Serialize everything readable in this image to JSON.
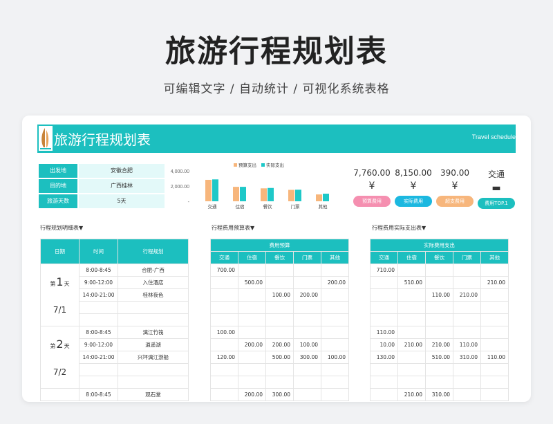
{
  "hero": {
    "title": "旅游行程规划表",
    "subtitle": "可编辑文字 / 自动统计 / 可视化系统表格"
  },
  "banner": {
    "title": "旅游行程规划表",
    "en": "Travel schedule"
  },
  "info": [
    {
      "key": "出发地",
      "value": "安徽合肥"
    },
    {
      "key": "目的地",
      "value": "广西桂林"
    },
    {
      "key": "旅游天数",
      "value": "5天"
    }
  ],
  "chart_data": {
    "type": "bar",
    "categories": [
      "交通",
      "住宿",
      "餐饮",
      "门票",
      "其他"
    ],
    "series": [
      {
        "name": "预算支出",
        "color": "#f7b67c",
        "values": [
          2820,
          1900,
          1700,
          1500,
          900
        ]
      },
      {
        "name": "实际支出",
        "color": "#1ec8c8",
        "values": [
          2880,
          1900,
          1750,
          1520,
          1000
        ]
      }
    ],
    "ylim": [
      0,
      4000
    ],
    "yticks": [
      "4,000.00",
      "2,000.00",
      "-"
    ],
    "legend": "top"
  },
  "kpis": [
    {
      "value": "7,760.00",
      "icon": "¥",
      "label": "预算费用",
      "color": "#f58fb0"
    },
    {
      "value": "8,150.00",
      "icon": "¥",
      "label": "实际费用",
      "color": "#1cb8e0"
    },
    {
      "value": "390.00",
      "icon": "¥",
      "label": "超支费用",
      "color": "#f7b67c"
    },
    {
      "value": "交通",
      "icon": "▬",
      "label": "费用TOP.1",
      "color": "#1cbfbf"
    }
  ],
  "sections": {
    "detail": "行程规划明细表▼",
    "budget": "行程费用预算表▼",
    "actual": "行程费用实际支出表▼"
  },
  "detail_table": {
    "headers": [
      "日期",
      "时间",
      "行程规划"
    ],
    "days": [
      {
        "num": "1",
        "prefix": "第",
        "suffix": "天",
        "date": "7/1",
        "rows": [
          [
            "8:00-8:45",
            "合肥-广西"
          ],
          [
            "9:00-12:00",
            "入住酒店"
          ],
          [
            "14:00-21:00",
            "桂林夜色"
          ],
          [
            "",
            ""
          ],
          [
            "",
            ""
          ]
        ]
      },
      {
        "num": "2",
        "prefix": "第",
        "suffix": "天",
        "date": "7/2",
        "rows": [
          [
            "8:00-8:45",
            "漓江竹筏"
          ],
          [
            "9:00-12:00",
            "逍遥湖"
          ],
          [
            "14:00-21:00",
            "兴坪漓江游船"
          ],
          [
            "",
            ""
          ],
          [
            "",
            ""
          ]
        ]
      }
    ],
    "last_row": [
      "8:00-8:45",
      "观石堂"
    ]
  },
  "budget_table": {
    "group": "费用预算",
    "headers": [
      "交通",
      "住宿",
      "餐饮",
      "门票",
      "其他"
    ],
    "rows": [
      [
        "700.00",
        "",
        "",
        "",
        ""
      ],
      [
        "",
        "500.00",
        "",
        "",
        "200.00"
      ],
      [
        "",
        "",
        "100.00",
        "200.00",
        ""
      ],
      [
        "",
        "",
        "",
        "",
        ""
      ],
      [
        "",
        "",
        "",
        "",
        ""
      ],
      [
        "100.00",
        "",
        "",
        "",
        ""
      ],
      [
        "",
        "200.00",
        "200.00",
        "100.00",
        ""
      ],
      [
        "120.00",
        "",
        "500.00",
        "300.00",
        "100.00"
      ],
      [
        "",
        "",
        "",
        "",
        ""
      ],
      [
        "",
        "",
        "",
        "",
        ""
      ],
      [
        "",
        "200.00",
        "300.00",
        "",
        ""
      ]
    ]
  },
  "actual_table": {
    "group": "实际费用支出",
    "headers": [
      "交通",
      "住宿",
      "餐饮",
      "门票",
      "其他"
    ],
    "rows": [
      [
        "710.00",
        "",
        "",
        "",
        ""
      ],
      [
        "",
        "510.00",
        "",
        "",
        "210.00"
      ],
      [
        "",
        "",
        "110.00",
        "210.00",
        ""
      ],
      [
        "",
        "",
        "",
        "",
        ""
      ],
      [
        "",
        "",
        "",
        "",
        ""
      ],
      [
        "110.00",
        "",
        "",
        "",
        ""
      ],
      [
        "10.00",
        "210.00",
        "210.00",
        "110.00",
        ""
      ],
      [
        "130.00",
        "",
        "510.00",
        "310.00",
        "110.00"
      ],
      [
        "",
        "",
        "",
        "",
        ""
      ],
      [
        "",
        "",
        "",
        "",
        ""
      ],
      [
        "",
        "210.00",
        "310.00",
        "",
        ""
      ]
    ]
  }
}
